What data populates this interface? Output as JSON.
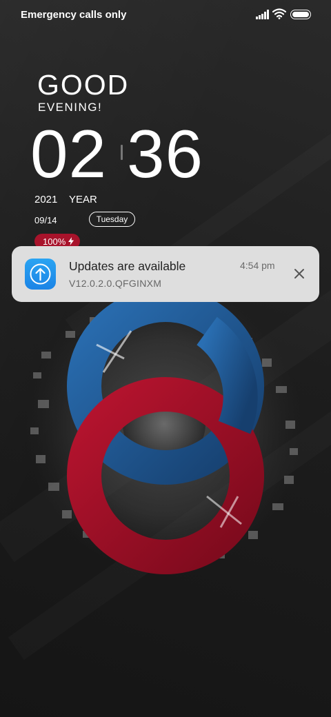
{
  "status_bar": {
    "carrier_text": "Emergency calls only",
    "icons": [
      "signal-icon",
      "wifi-icon",
      "battery-icon"
    ]
  },
  "lock_screen": {
    "greeting": "GOOD",
    "greeting_sub": "EVENING!",
    "clock_hours": "02",
    "clock_minutes": "36",
    "year": "2021",
    "year_label": "YEAR",
    "date": "09/14",
    "weekday": "Tuesday",
    "battery_level": "100%",
    "battery_pill_color": "#a8132b"
  },
  "notification": {
    "title": "Updates are available",
    "subtitle": "V12.0.2.0.QFGINXM",
    "time": "4:54 pm",
    "app_icon": "arrow-up-icon",
    "icon_color": "#1b84e6"
  },
  "colors": {
    "ring_blue": "#1c5a97",
    "ring_red": "#a5112a",
    "background": "#1c1c1c"
  }
}
